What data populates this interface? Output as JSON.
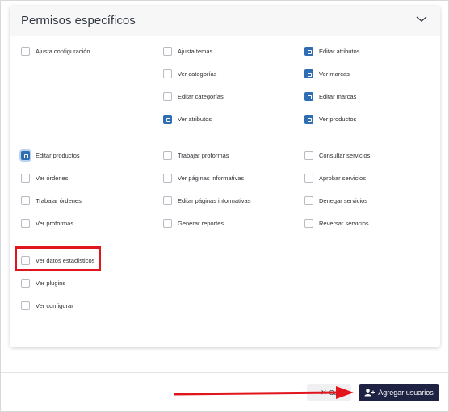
{
  "panel": {
    "title": "Permisos específicos"
  },
  "permissions": [
    {
      "label": "Ajusta configuración",
      "checked": false
    },
    {
      "label": "Ajusta temas",
      "checked": false
    },
    {
      "label": "Editar atributos",
      "checked": true
    },
    {
      "label": "Ver categorías",
      "checked": false
    },
    {
      "label": "Ver marcas",
      "checked": true
    },
    {
      "label": "Editar categorías",
      "checked": false
    },
    {
      "label": "Editar marcas",
      "checked": true
    },
    {
      "label": "Ver atributos",
      "checked": true
    },
    {
      "label": "Ver productos",
      "checked": true
    },
    {
      "label": "Editar productos",
      "checked": true
    },
    {
      "label": "Trabajar proformas",
      "checked": false
    },
    {
      "label": "Consultar servicios",
      "checked": false
    },
    {
      "label": "Ver órdenes",
      "checked": false
    },
    {
      "label": "Ver páginas informativas",
      "checked": false
    },
    {
      "label": "Aprobar servicios",
      "checked": false
    },
    {
      "label": "Trabajar órdenes",
      "checked": false
    },
    {
      "label": "Editar páginas informativas",
      "checked": false
    },
    {
      "label": "Denegar servicios",
      "checked": false
    },
    {
      "label": "Ver proformas",
      "checked": false
    },
    {
      "label": "Generar reportes",
      "checked": false
    },
    {
      "label": "Reversar servicios",
      "checked": false
    },
    {
      "label": "Ver datos estadísticos",
      "checked": false
    },
    {
      "label": "Ver plugins",
      "checked": false
    },
    {
      "label": "Ver configurar",
      "checked": false
    }
  ],
  "footer": {
    "cancel_label": "Ca",
    "add_users_label": "Agregar usuarios"
  },
  "colors": {
    "checked": "#2f6eb3",
    "primary_button": "#1e2343",
    "annotation": "#e0161c"
  },
  "icons": {
    "panel_toggle": "chevron-down-icon",
    "cancel": "close-icon",
    "add_users": "user-plus-icon"
  }
}
